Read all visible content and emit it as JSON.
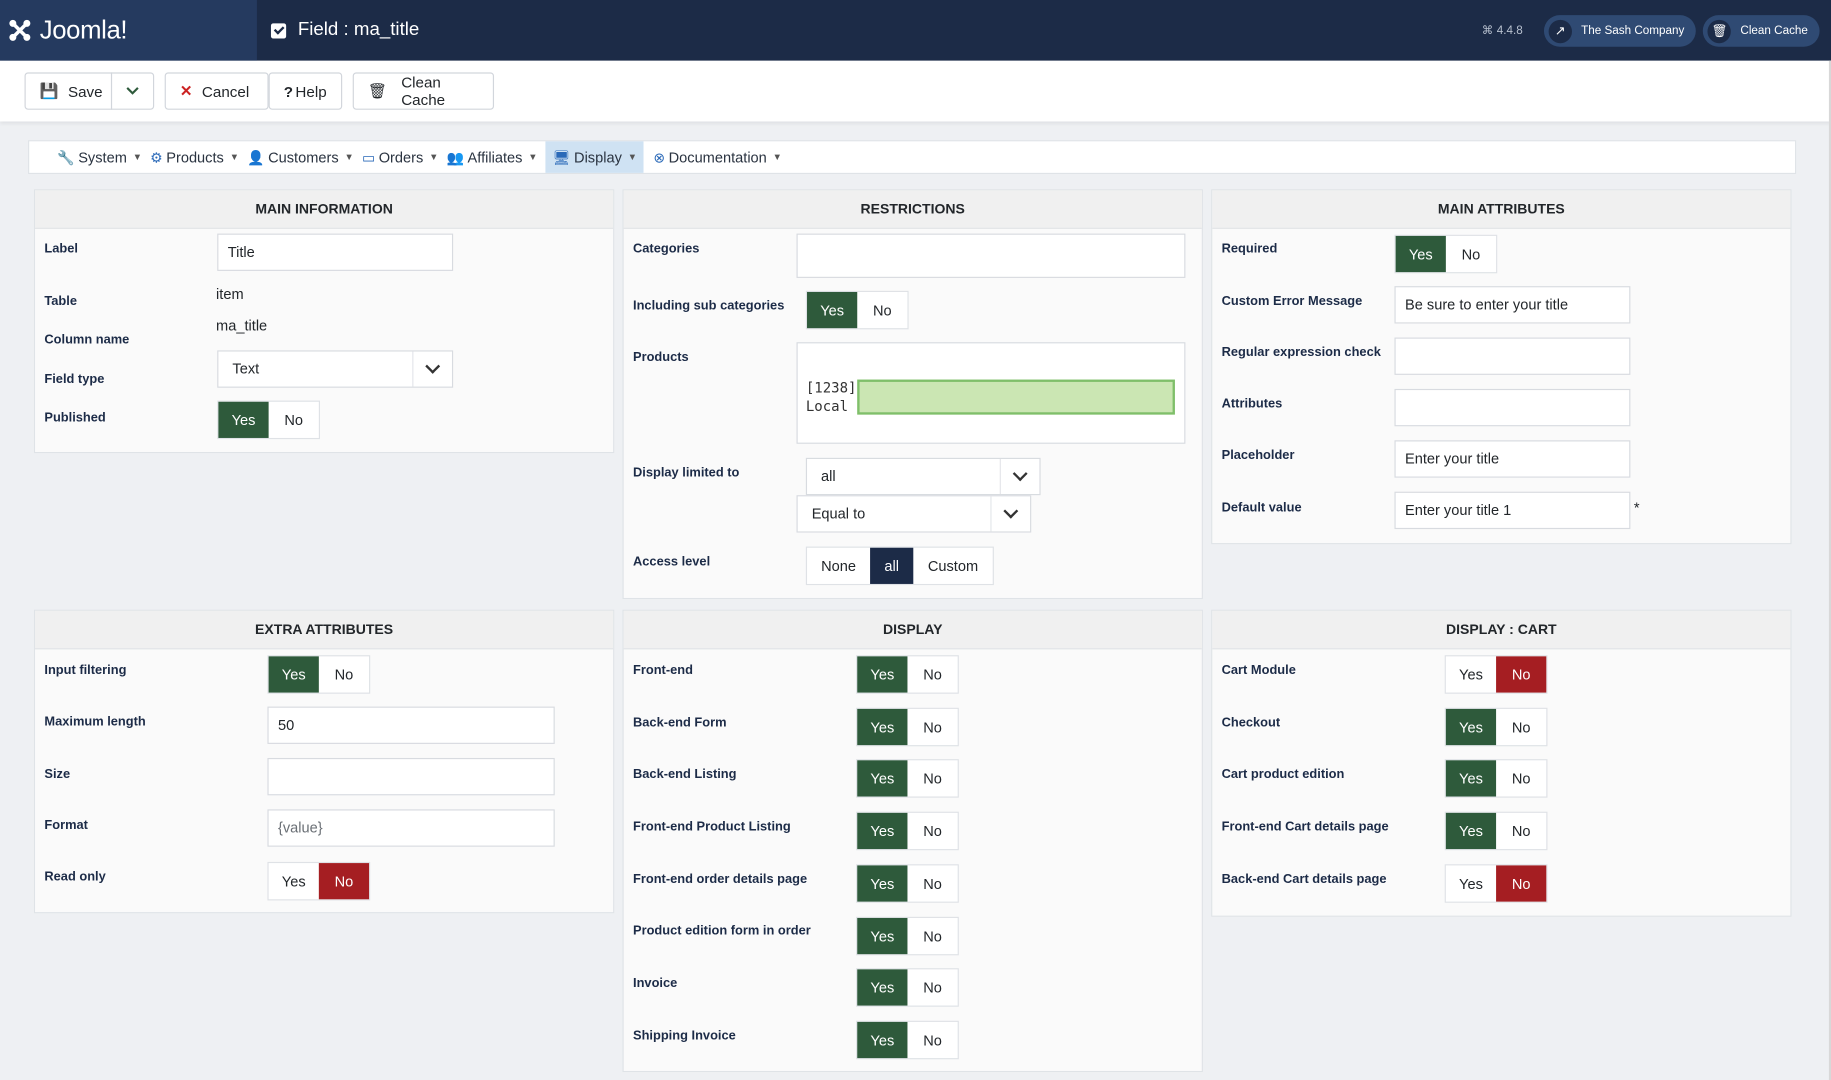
{
  "header": {
    "logo_text": "Joomla!",
    "page_title": "Field : ma_title",
    "version": "4.4.8",
    "site_button": "The Sash Company",
    "cache_button": "Clean Cache"
  },
  "toolbar": {
    "save": "Save",
    "cancel": "Cancel",
    "help": "Help",
    "clean_cache": "Clean Cache"
  },
  "menu": [
    {
      "label": "System",
      "icon": "wrench-icon"
    },
    {
      "label": "Products",
      "icon": "cubes-icon"
    },
    {
      "label": "Customers",
      "icon": "user-icon"
    },
    {
      "label": "Orders",
      "icon": "credit-card-icon"
    },
    {
      "label": "Affiliates",
      "icon": "users-icon"
    },
    {
      "label": "Display",
      "icon": "monitor-icon",
      "active": true
    },
    {
      "label": "Documentation",
      "icon": "lifebuoy-icon"
    }
  ],
  "main_info": {
    "title": "MAIN INFORMATION",
    "label_lbl": "Label",
    "label_val": "Title",
    "table_lbl": "Table",
    "table_val": "item",
    "column_lbl": "Column name",
    "column_val": "ma_title",
    "fieldtype_lbl": "Field type",
    "fieldtype_val": "Text",
    "published_lbl": "Published",
    "yes": "Yes",
    "no": "No"
  },
  "restrictions": {
    "title": "RESTRICTIONS",
    "categories_lbl": "Categories",
    "subcat_lbl": "Including sub categories",
    "products_lbl": "Products",
    "product_chip_1": "[1238]",
    "product_chip_2": "Local P",
    "display_lbl": "Display limited to",
    "display_val": "all",
    "display_cond": "Equal to",
    "access_lbl": "Access level",
    "access_opts": [
      "None",
      "all",
      "Custom"
    ],
    "yes": "Yes",
    "no": "No"
  },
  "main_attr": {
    "title": "MAIN ATTRIBUTES",
    "required_lbl": "Required",
    "error_lbl": "Custom Error Message",
    "error_val": "Be sure to enter your title",
    "regex_lbl": "Regular expression check",
    "attrs_lbl": "Attributes",
    "ph_lbl": "Placeholder",
    "ph_val": "Enter your title",
    "default_lbl": "Default value",
    "default_val": "Enter your title 1",
    "asterisk": "*",
    "yes": "Yes",
    "no": "No"
  },
  "extra_attr": {
    "title": "EXTRA ATTRIBUTES",
    "filter_lbl": "Input filtering",
    "maxlen_lbl": "Maximum length",
    "maxlen_val": "50",
    "size_lbl": "Size",
    "format_lbl": "Format",
    "format_val": "{value}",
    "readonly_lbl": "Read only",
    "yes": "Yes",
    "no": "No"
  },
  "display": {
    "title": "DISPLAY",
    "rows": [
      "Front-end",
      "Back-end Form",
      "Back-end Listing",
      "Front-end Product Listing",
      "Front-end order details page",
      "Product edition form in order",
      "Invoice",
      "Shipping Invoice"
    ],
    "yes": "Yes",
    "no": "No"
  },
  "display_cart": {
    "title": "DISPLAY : CART",
    "rows": [
      {
        "label": "Cart Module",
        "value": "No"
      },
      {
        "label": "Checkout",
        "value": "Yes"
      },
      {
        "label": "Cart product edition",
        "value": "Yes"
      },
      {
        "label": "Front-end Cart details page",
        "value": "Yes"
      },
      {
        "label": "Back-end Cart details page",
        "value": "No"
      }
    ],
    "yes": "Yes",
    "no": "No"
  },
  "colors": {
    "header": "#1c2b47",
    "yes_active": "#2e5a3b",
    "no_active": "#a51e22",
    "menu_active": "#cfe2f3"
  }
}
